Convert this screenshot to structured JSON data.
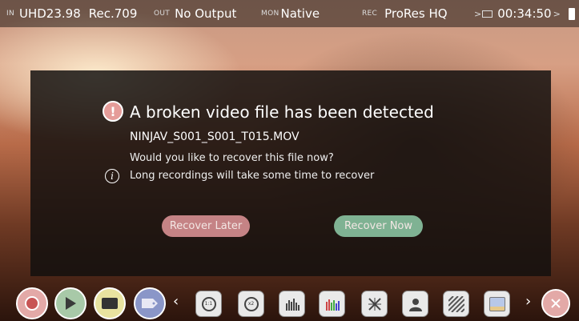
{
  "status_bar": {
    "input_tag": "IN",
    "input_format": "UHD23.98",
    "input_colorspace": "Rec.709",
    "output_tag": "OUT",
    "output_value": "No Output",
    "monitor_tag": "MON",
    "monitor_value": "Native",
    "record_tag": "REC",
    "record_codec": "ProRes HQ",
    "record_time": "00:34:50"
  },
  "dialog": {
    "title": "A broken video file has been detected",
    "filename": "NINJAV_S001_S001_T015.MOV",
    "question": "Would you like to recover this file now?",
    "note": "Long recordings will take some time to recover",
    "warning_glyph": "!",
    "info_glyph": "i",
    "recover_later_label": "Recover Later",
    "recover_now_label": "Recover Now"
  },
  "toolbar": {
    "zoom_1_1": "1:1",
    "zoom_x2": "x2"
  },
  "colors": {
    "recover_later": "#c58385",
    "recover_now": "#7fb293",
    "record_button": "#e3a9a7",
    "play_button": "#a8c9a8",
    "monitor_button": "#e8e3a0",
    "tag_button": "#8a96c8"
  }
}
